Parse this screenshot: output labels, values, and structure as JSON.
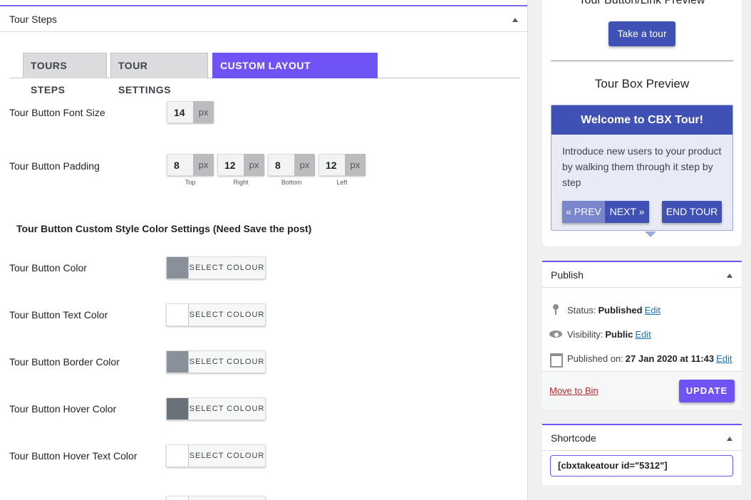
{
  "main": {
    "title": "Tour Steps",
    "tabs": [
      {
        "label": "TOURS STEPS"
      },
      {
        "label": "TOUR SETTINGS"
      },
      {
        "label": "CUSTOM LAYOUT STYLE(PRO)"
      }
    ],
    "font_size": {
      "label": "Tour Button Font Size",
      "value": "14",
      "unit": "px"
    },
    "padding": {
      "label": "Tour Button Padding",
      "fields": [
        {
          "value": "8",
          "unit": "px",
          "caption": "Top"
        },
        {
          "value": "12",
          "unit": "px",
          "caption": "Right"
        },
        {
          "value": "8",
          "unit": "px",
          "caption": "Bottom"
        },
        {
          "value": "12",
          "unit": "px",
          "caption": "Left"
        }
      ]
    },
    "section_title": "Tour Button Custom Style Color Settings (Need Save the post)",
    "colors": [
      {
        "label": "Tour Button Color",
        "swatch": "#8a9099",
        "button": "SELECT COLOUR"
      },
      {
        "label": "Tour Button Text Color",
        "swatch": "#ffffff",
        "button": "SELECT COLOUR"
      },
      {
        "label": "Tour Button Border Color",
        "swatch": "#8a9099",
        "button": "SELECT COLOUR"
      },
      {
        "label": "Tour Button Hover Color",
        "swatch": "#6b7178",
        "button": "SELECT COLOUR"
      },
      {
        "label": "Tour Button Hover Text Color",
        "swatch": "#ffffff",
        "button": "SELECT COLOUR"
      }
    ]
  },
  "preview": {
    "link_heading": "Tour Button/Link Preview",
    "take_tour": "Take a tour",
    "box_heading": "Tour Box Preview",
    "tour_title": "Welcome to CBX Tour!",
    "tour_body": "Introduce new users to your product by walking them through it step by step",
    "prev": "« PREV",
    "next": "NEXT »",
    "end": "END TOUR"
  },
  "publish": {
    "title": "Publish",
    "status_label": "Status:",
    "status_value": "Published",
    "visibility_label": "Visibility:",
    "visibility_value": "Public",
    "published_label": "Published on:",
    "published_value": "27 Jan 2020 at 11:43",
    "edit": "Edit",
    "move_to_bin": "Move to Bin",
    "update": "UPDATE"
  },
  "shortcode": {
    "title": "Shortcode",
    "value": "[cbxtakeatour id=\"5312\"]"
  },
  "colors": {
    "accent": "#7053f5",
    "tour_blue": "#3f51b5",
    "tour_light": "#7986cb"
  }
}
